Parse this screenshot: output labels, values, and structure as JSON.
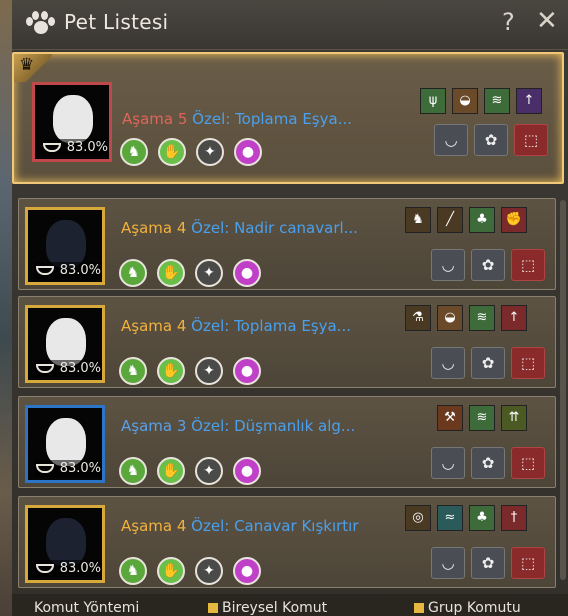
{
  "window": {
    "title": "Pet Listesi",
    "help": "?",
    "close": "✕"
  },
  "pets": [
    {
      "selected": true,
      "food": "83.0%",
      "stage": "Aşama 5",
      "special": "Özel: Toplama Eşya...",
      "stage_color": "red",
      "skills": [
        {
          "name": "harvest-icon",
          "color": "#3d6b3a"
        },
        {
          "name": "bird-icon",
          "color": "#6b4a2a"
        },
        {
          "name": "wing-icon",
          "color": "#3d6b3a"
        },
        {
          "name": "pickaxe-up-icon",
          "color": "#4a2e6a"
        }
      ]
    },
    {
      "selected": false,
      "food": "83.0%",
      "stage": "Aşama 4",
      "special": "Özel: Nadir canavarl...",
      "stage_color": "gold",
      "skills": [
        {
          "name": "horse-icon",
          "color": "#4a3a24"
        },
        {
          "name": "rifle-icon",
          "color": "#4a3a24"
        },
        {
          "name": "clover-icon",
          "color": "#3d6b3a"
        },
        {
          "name": "fist-icon",
          "color": "#7a2a2a"
        }
      ]
    },
    {
      "selected": false,
      "food": "83.0%",
      "stage": "Aşama 4",
      "special": "Özel: Toplama Eşya...",
      "stage_color": "gold",
      "skills": [
        {
          "name": "potion-icon",
          "color": "#4a3a24"
        },
        {
          "name": "bird-icon",
          "color": "#6b4a2a"
        },
        {
          "name": "wing-icon",
          "color": "#3d6b3a"
        },
        {
          "name": "pickaxe-up-icon",
          "color": "#7a2a2a"
        }
      ]
    },
    {
      "selected": false,
      "food": "83.0%",
      "stage": "Aşama 3",
      "special": "Özel: Düşmanlık alg...",
      "stage_color": "blue",
      "skills": [
        {
          "name": "hammer-icon",
          "color": "#6b3a1e"
        },
        {
          "name": "wing-icon",
          "color": "#3d6b3a"
        },
        {
          "name": "arrows-up-icon",
          "color": "#4a5a22"
        }
      ]
    },
    {
      "selected": false,
      "food": "83.0%",
      "stage": "Aşama 4",
      "special": "Özel: Canavar Kışkırtır",
      "stage_color": "gold",
      "skills": [
        {
          "name": "carriage-icon",
          "color": "#4a3a24"
        },
        {
          "name": "fish-icon",
          "color": "#2a5a5a"
        },
        {
          "name": "clover-icon",
          "color": "#3d6b3a"
        },
        {
          "name": "sword-up-icon",
          "color": "#7a2a2a"
        }
      ]
    }
  ],
  "bottom": {
    "command_method": "Komut Yöntemi",
    "individual": "Bireysel Komut",
    "group": "Grup Komutu"
  }
}
